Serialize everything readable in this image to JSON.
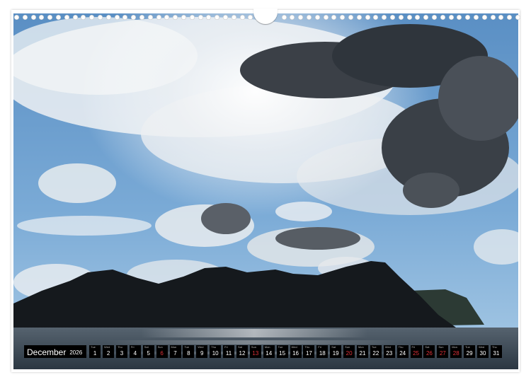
{
  "calendar": {
    "month": "December",
    "year": "2026",
    "days": [
      {
        "n": "1",
        "wd": "Tue",
        "weekend": false
      },
      {
        "n": "2",
        "wd": "Wed",
        "weekend": false
      },
      {
        "n": "3",
        "wd": "Thu",
        "weekend": false
      },
      {
        "n": "4",
        "wd": "Fri",
        "weekend": false
      },
      {
        "n": "5",
        "wd": "Sat",
        "weekend": false
      },
      {
        "n": "6",
        "wd": "Sun",
        "weekend": true
      },
      {
        "n": "7",
        "wd": "Mon",
        "weekend": false
      },
      {
        "n": "8",
        "wd": "Tue",
        "weekend": false
      },
      {
        "n": "9",
        "wd": "Wed",
        "weekend": false
      },
      {
        "n": "10",
        "wd": "Thu",
        "weekend": false
      },
      {
        "n": "11",
        "wd": "Fri",
        "weekend": false
      },
      {
        "n": "12",
        "wd": "Sat",
        "weekend": false
      },
      {
        "n": "13",
        "wd": "Sun",
        "weekend": true
      },
      {
        "n": "14",
        "wd": "Mon",
        "weekend": false
      },
      {
        "n": "15",
        "wd": "Tue",
        "weekend": false
      },
      {
        "n": "16",
        "wd": "Wed",
        "weekend": false
      },
      {
        "n": "17",
        "wd": "Thu",
        "weekend": false
      },
      {
        "n": "18",
        "wd": "Fri",
        "weekend": false
      },
      {
        "n": "19",
        "wd": "Sat",
        "weekend": false
      },
      {
        "n": "20",
        "wd": "Sun",
        "weekend": true
      },
      {
        "n": "21",
        "wd": "Mon",
        "weekend": false
      },
      {
        "n": "22",
        "wd": "Tue",
        "weekend": false
      },
      {
        "n": "23",
        "wd": "Wed",
        "weekend": false
      },
      {
        "n": "24",
        "wd": "Thu",
        "weekend": false
      },
      {
        "n": "25",
        "wd": "Fri",
        "weekend": true
      },
      {
        "n": "26",
        "wd": "Sat",
        "weekend": true
      },
      {
        "n": "27",
        "wd": "Sun",
        "weekend": true
      },
      {
        "n": "28",
        "wd": "Mon",
        "weekend": true
      },
      {
        "n": "29",
        "wd": "Tue",
        "weekend": false
      },
      {
        "n": "30",
        "wd": "Wed",
        "weekend": false
      },
      {
        "n": "31",
        "wd": "Thu",
        "weekend": false
      }
    ]
  },
  "colors": {
    "sky_top": "#5f93c6",
    "sky_bottom": "#9cc3e4",
    "mountain": "#161a1e",
    "sea": "#3c4a57",
    "holiday": "#e0323a"
  }
}
